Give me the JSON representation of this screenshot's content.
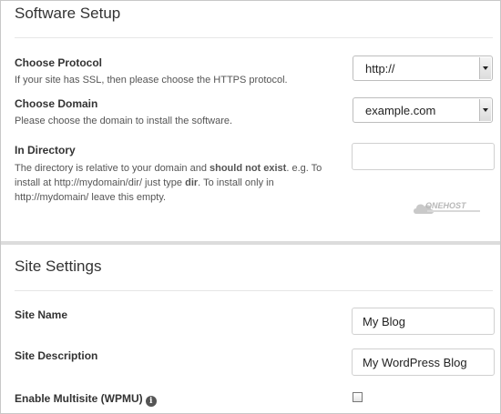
{
  "software_setup": {
    "title": "Software Setup",
    "protocol": {
      "label": "Choose Protocol",
      "hint": "If your site has SSL, then please choose the HTTPS protocol.",
      "selected": "http://"
    },
    "domain": {
      "label": "Choose Domain",
      "hint": "Please choose the domain to install the software.",
      "selected": "example.com"
    },
    "directory": {
      "label": "In Directory",
      "hint_part1": "The directory is relative to your domain and ",
      "hint_bold1": "should not exist",
      "hint_part2": ". e.g. To install at http://mydomain/dir/ just type ",
      "hint_bold2": "dir",
      "hint_part3": ". To install only in http://mydomain/ leave this empty.",
      "value": ""
    },
    "logo_text": "ONEHOST"
  },
  "site_settings": {
    "title": "Site Settings",
    "site_name": {
      "label": "Site Name",
      "value": "My Blog"
    },
    "site_description": {
      "label": "Site Description",
      "value": "My WordPress Blog"
    },
    "multisite": {
      "label": "Enable Multisite (WPMU)",
      "checked": false
    }
  }
}
